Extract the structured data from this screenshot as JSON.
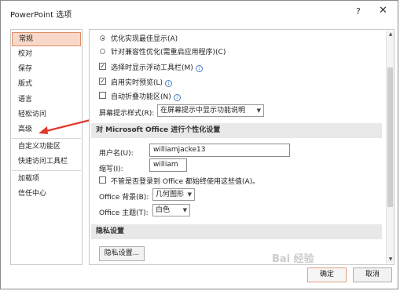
{
  "window": {
    "title": "PowerPoint 选项",
    "help_glyph": "?",
    "close_glyph": "✕"
  },
  "sidebar": {
    "items": [
      {
        "label": "常规"
      },
      {
        "label": "校对"
      },
      {
        "label": "保存"
      },
      {
        "label": "版式"
      },
      {
        "label": "语言"
      },
      {
        "label": "轻松访问"
      },
      {
        "label": "高级"
      },
      {
        "label": "自定义功能区"
      },
      {
        "label": "快速访问工具栏"
      },
      {
        "label": "加载项"
      },
      {
        "label": "信任中心"
      }
    ],
    "selected_index": 0
  },
  "general": {
    "radio_best_appearance": "优化实现最佳显示(A)",
    "radio_compat": "针对兼容性优化(需重启应用程序)(C)",
    "check_mini_toolbar": "选择时显示浮动工具栏(M)",
    "check_live_preview": "启用实时预览(L)",
    "check_collapse_ribbon": "自动折叠功能区(N)",
    "tooltip_style_label": "屏幕提示样式(R):",
    "tooltip_style_value": "在屏幕提示中显示功能说明",
    "info_glyph": "i"
  },
  "personalize": {
    "header": "对 Microsoft Office 进行个性化设置",
    "username_label": "用户名(U):",
    "username_value": "williamjacke13",
    "initials_label": "缩写(I):",
    "initials_value": "william",
    "always_use_label": "不管是否登录到 Office 都始终使用这些值(A)。",
    "background_label": "Office 背景(B):",
    "background_value": "几何图形",
    "theme_label": "Office 主题(T):",
    "theme_value": "白色"
  },
  "privacy": {
    "header": "隐私设置",
    "button_label": "隐私设置..."
  },
  "footer": {
    "ok_label": "确定",
    "cancel_label": "取消"
  },
  "watermark": "Bai 经验",
  "colors": {
    "selected_bg": "#f8d9c9",
    "selected_border": "#e28c62",
    "arrow": "#e03a2e",
    "info": "#4a7fc6"
  }
}
